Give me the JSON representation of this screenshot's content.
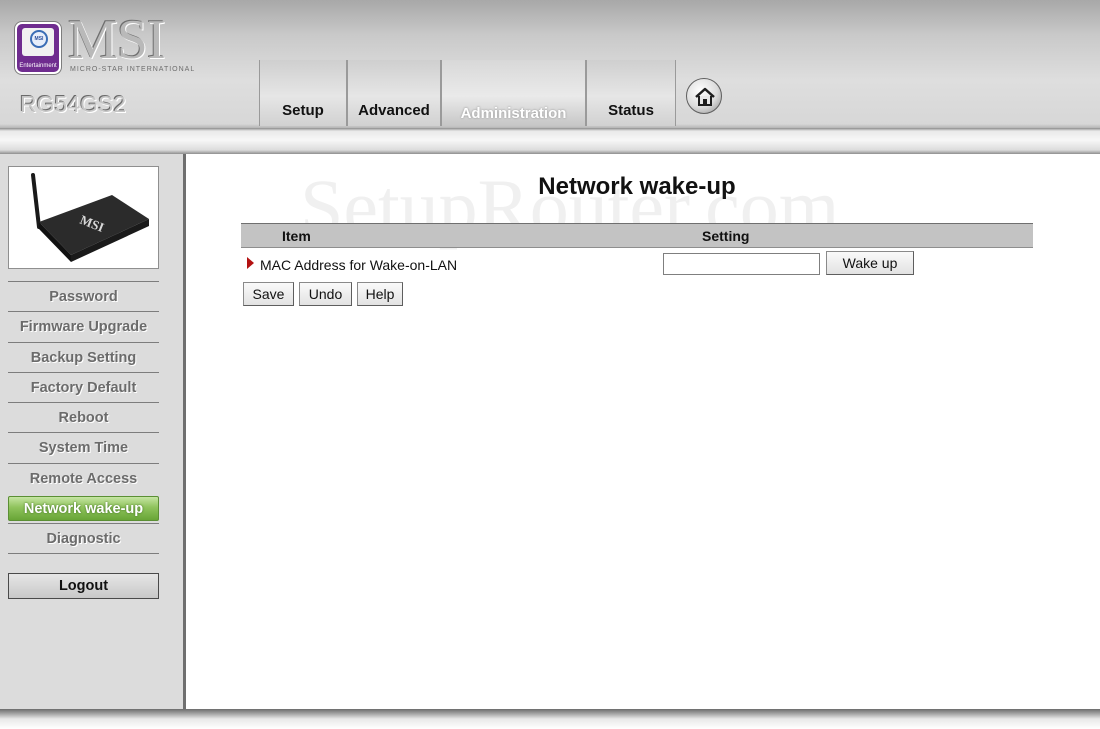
{
  "header": {
    "brand": "MSI",
    "brand_tagline": "MICRO-STAR INTERNATIONAL",
    "model": "RG54GS2",
    "badge_seal": "MSI",
    "badge_subtext": "Entertainment",
    "tabs": [
      {
        "label": "Setup",
        "active": false
      },
      {
        "label": "Advanced",
        "active": false
      },
      {
        "label": "Administration",
        "active": true
      },
      {
        "label": "Status",
        "active": false
      }
    ],
    "home_icon": "home-icon"
  },
  "watermark": "SetupRouter.com",
  "sidebar": {
    "router_image_label": "MSI",
    "items": [
      {
        "label": "Password",
        "active": false
      },
      {
        "label": "Firmware Upgrade",
        "active": false
      },
      {
        "label": "Backup Setting",
        "active": false
      },
      {
        "label": "Factory Default",
        "active": false
      },
      {
        "label": "Reboot",
        "active": false
      },
      {
        "label": "System Time",
        "active": false
      },
      {
        "label": "Remote Access",
        "active": false
      },
      {
        "label": "Network wake-up",
        "active": true
      },
      {
        "label": "Diagnostic",
        "active": false
      }
    ],
    "logout_label": "Logout",
    "active_color": "#8fc35c"
  },
  "main": {
    "title": "Network wake-up",
    "table": {
      "col_item": "Item",
      "col_setting": "Setting",
      "rows": [
        {
          "label": "MAC Address for Wake-on-LAN",
          "value": "",
          "button": "Wake up"
        }
      ]
    },
    "buttons": {
      "save": "Save",
      "undo": "Undo",
      "help": "Help"
    },
    "marker_color": "#b31212"
  }
}
